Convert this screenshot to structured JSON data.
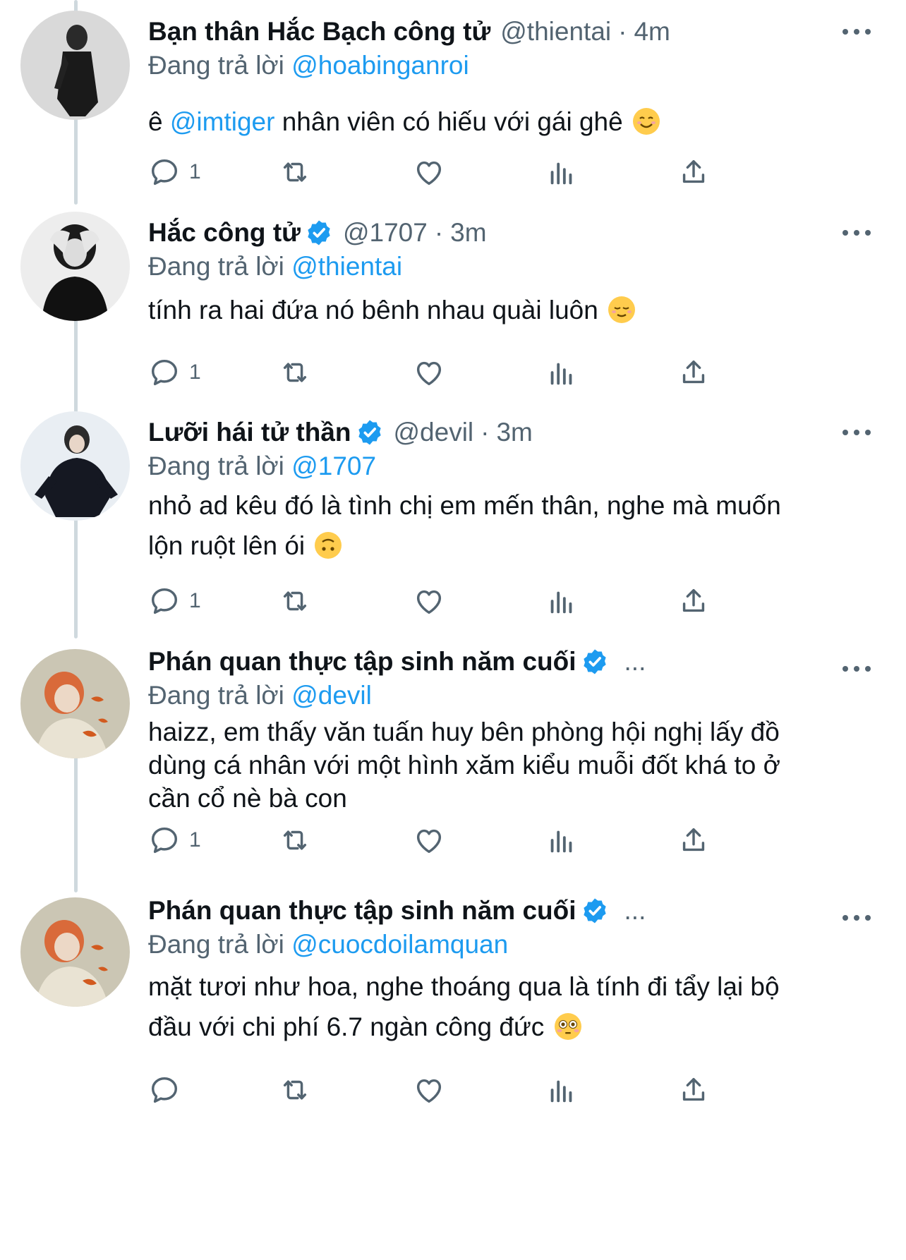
{
  "replying_label": "Đang trả lời",
  "tweets": [
    {
      "name": "Bạn thân Hắc Bạch công tử",
      "verified": false,
      "handle": "@thientai",
      "separator": "·",
      "time": "4m",
      "reply_to": "@hoabinganroi",
      "text_before": "ê ",
      "text_mention": "@imtiger",
      "text_after": " nhân viên có hiếu với gái ghê",
      "text_line2": "",
      "emoji": "smiling-face-icon",
      "reply_count": "1"
    },
    {
      "name": "Hắc công tử",
      "verified": true,
      "handle": "@1707",
      "separator": "·",
      "time": "3m",
      "reply_to": "@thientai",
      "text_before": "tính ra hai đứa nó bênh nhau quài luôn",
      "text_mention": "",
      "text_after": "",
      "text_line2": "",
      "emoji": "relieved-face-icon",
      "reply_count": "1"
    },
    {
      "name": "Lưỡi hái tử thần",
      "verified": true,
      "handle": "@devil",
      "separator": "·",
      "time": "3m",
      "reply_to": "@1707",
      "text_line1": "nhỏ ad kêu đó là tình chị em mến thân, nghe mà muốn",
      "text_line2": "lộn ruột lên ói",
      "emoji": "upside-down-face-icon",
      "reply_count": "1"
    },
    {
      "name": "Phán quan thực tập sinh năm cuối",
      "verified": true,
      "handle_truncated": "...",
      "reply_to": "@devil",
      "text_line1": "haizz, em thấy văn tuấn huy bên phòng hội nghị lấy đồ",
      "text_line2": "dùng cá nhân với một hình xăm kiểu muỗi đốt khá to ở",
      "text_line3": "cần cổ nè bà con",
      "reply_count": "1"
    },
    {
      "name": "Phán quan thực tập sinh năm cuối",
      "verified": true,
      "handle_truncated": "...",
      "reply_to": "@cuocdoilamquan",
      "text_line1": "mặt tươi như hoa, nghe thoáng qua là tính đi tẩy lại bộ",
      "text_line2": "đầu với chi phí 6.7 ngàn công đức",
      "emoji": "flushed-face-icon",
      "reply_count": ""
    }
  ],
  "colors": {
    "accent": "#1d9bf0",
    "muted": "#536471",
    "text": "#0f1419",
    "thread_line": "#cfd9de"
  }
}
